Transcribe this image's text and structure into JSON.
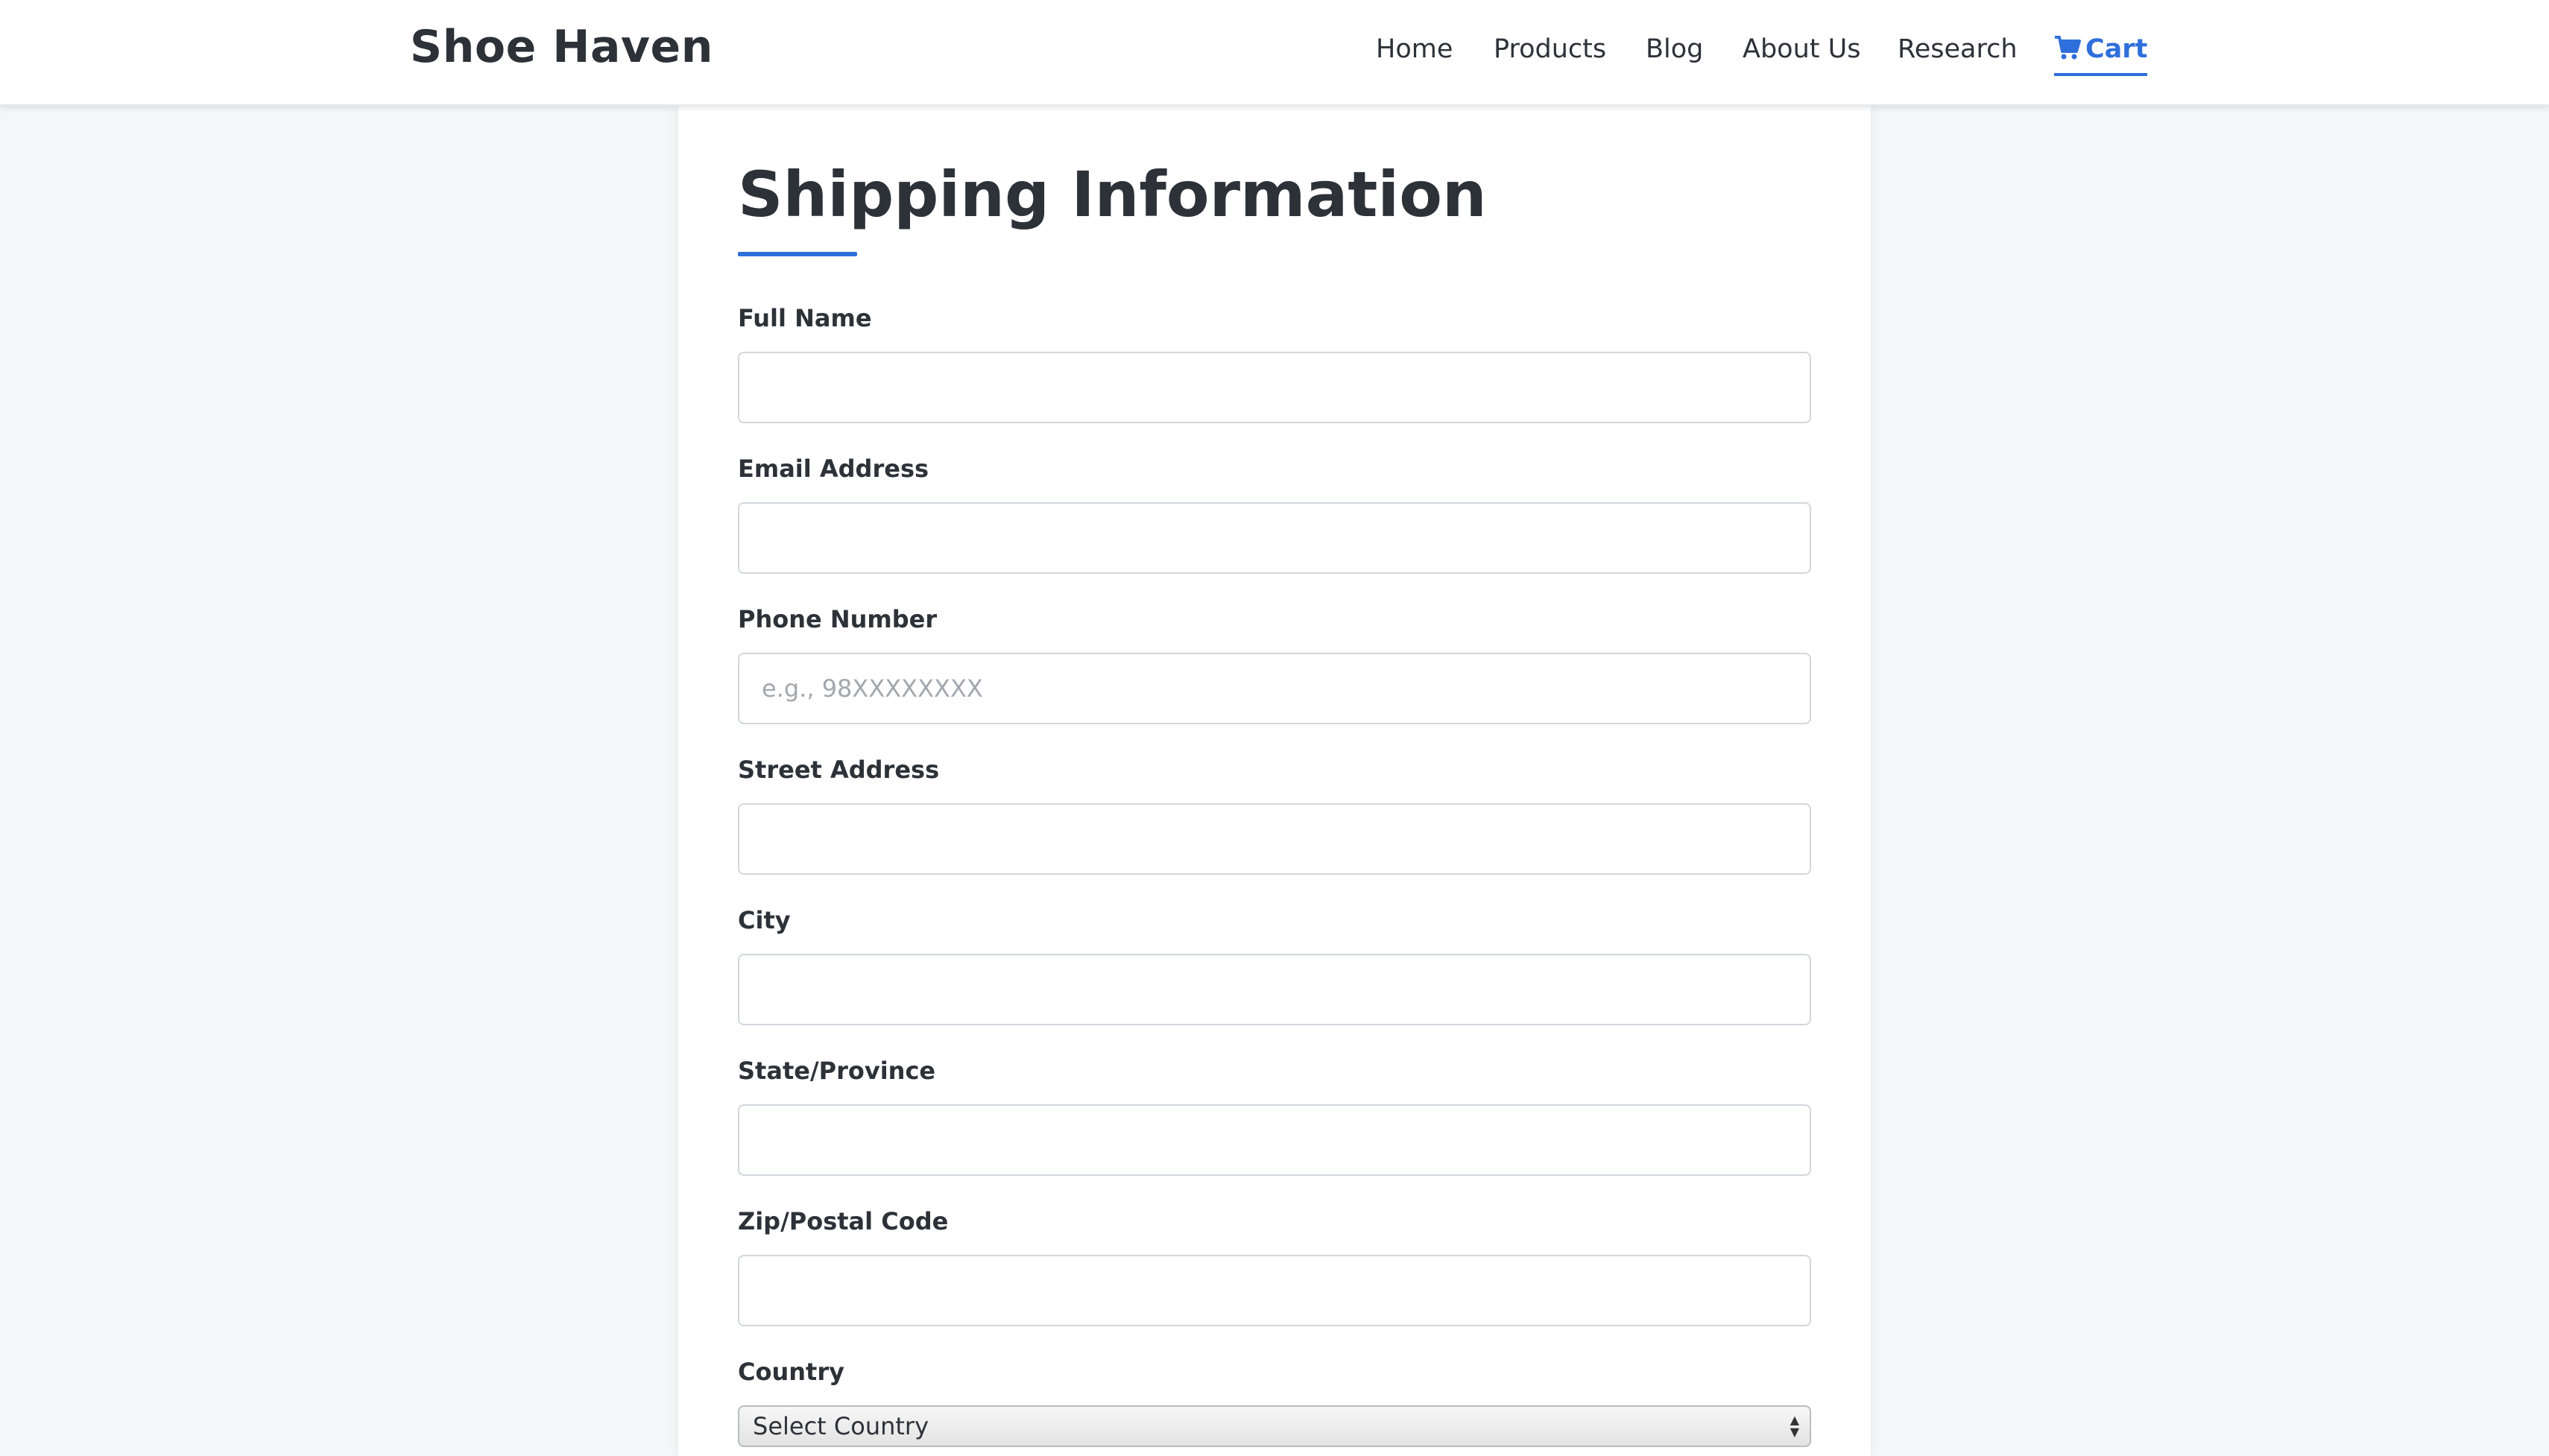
{
  "navbar": {
    "brand": "Shoe Haven",
    "links": [
      {
        "label": "Home"
      },
      {
        "label": "Products"
      },
      {
        "label": "Blog"
      },
      {
        "label": "About Us"
      },
      {
        "label": "Research"
      }
    ],
    "cart": {
      "label": "Cart",
      "icon": "cart-icon"
    }
  },
  "form": {
    "title": "Shipping Information",
    "fields": [
      {
        "label": "Full Name",
        "value": "",
        "placeholder": ""
      },
      {
        "label": "Email Address",
        "value": "",
        "placeholder": ""
      },
      {
        "label": "Phone Number",
        "value": "",
        "placeholder": "e.g., 98XXXXXXXX"
      },
      {
        "label": "Street Address",
        "value": "",
        "placeholder": ""
      },
      {
        "label": "City",
        "value": "",
        "placeholder": ""
      },
      {
        "label": "State/Province",
        "value": "",
        "placeholder": ""
      },
      {
        "label": "Zip/Postal Code",
        "value": "",
        "placeholder": ""
      }
    ],
    "country": {
      "label": "Country",
      "selected": "Select Country"
    }
  },
  "colors": {
    "accent": "#2f6fdb",
    "text": "#2d3239",
    "background": "#f4f6f8"
  }
}
